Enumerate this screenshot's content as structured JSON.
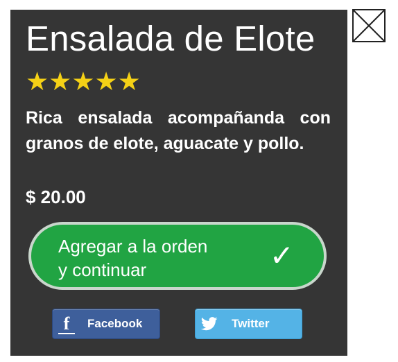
{
  "product": {
    "title": "Ensalada de Elote",
    "rating": 5,
    "stars": "★★★★★",
    "description": "Rica ensalada acompañanda con granos de elote, aguacate y pollo.",
    "price": "$ 20.00"
  },
  "actions": {
    "add_label_line1": "Agregar a la orden",
    "add_label_line2": "y continuar",
    "add_icon": "checkmark-icon"
  },
  "share": {
    "facebook_label": "Facebook",
    "facebook_icon": "facebook-icon",
    "twitter_label": "Twitter",
    "twitter_icon": "twitter-icon"
  },
  "close_icon": "close-icon",
  "colors": {
    "panel": "#353535",
    "star": "#f5d116",
    "add_button": "#21a443",
    "facebook": "#3e5f9b",
    "twitter": "#54b3e6"
  }
}
